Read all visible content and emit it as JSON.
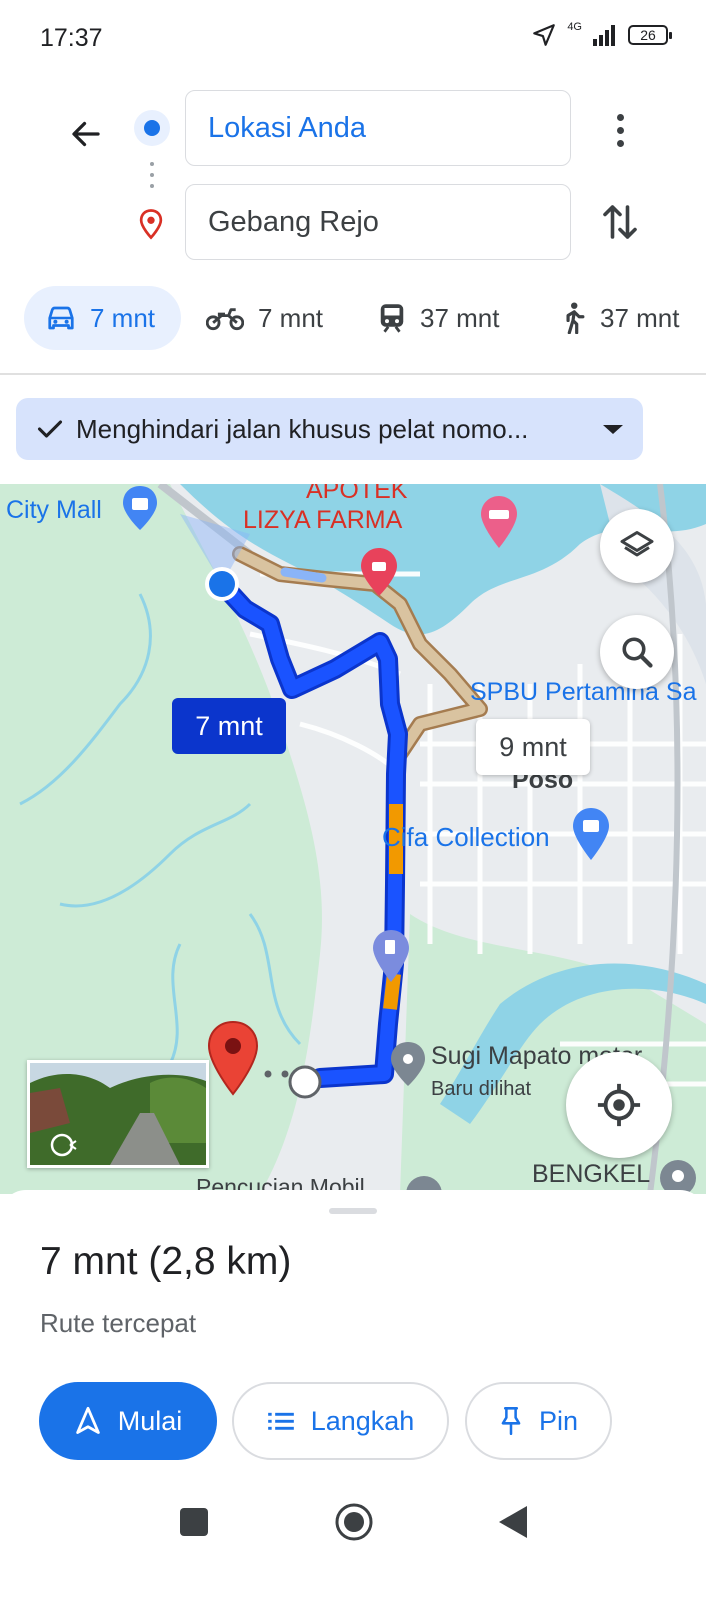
{
  "status_bar": {
    "time": "17:37",
    "network": "4G",
    "battery": "26"
  },
  "route": {
    "origin": "Lokasi Anda",
    "destination": "Gebang Rejo"
  },
  "travel_modes": [
    {
      "mode": "car",
      "label": "7 mnt",
      "active": true
    },
    {
      "mode": "motorcycle",
      "label": "7 mnt"
    },
    {
      "mode": "transit",
      "label": "37 mnt"
    },
    {
      "mode": "walk",
      "label": "37 mnt"
    }
  ],
  "options_chip": "Menghindari jalan khusus pelat nomo...",
  "map": {
    "labels": {
      "city_mall": "City Mall",
      "apotek": "APOTEK",
      "lizya": "LIZYA FARMA",
      "spbu": "SPBU Pertamina Sa",
      "poso": "Poso",
      "cifa": "Cifa Collection",
      "sugi": "Sugi Mapato motor",
      "recent": "Baru dilihat",
      "bengkel": "BENGKEL",
      "pencucian": "Pencucian Mobil"
    },
    "eta_primary": "7 mnt",
    "eta_alternate": "9 mnt"
  },
  "summary": {
    "duration_distance": "7 mnt (2,8 km)",
    "description": "Rute tercepat"
  },
  "actions": {
    "start": "Mulai",
    "steps": "Langkah",
    "pin": "Pin"
  },
  "colors": {
    "accent": "#1a73e8",
    "route_primary": "#1a53ff",
    "route_alt": "#d9c3a0",
    "traffic_slow": "#f29900",
    "destination_pin": "#d93025",
    "map_green": "#cfeedd",
    "water": "#8fd3e6"
  }
}
